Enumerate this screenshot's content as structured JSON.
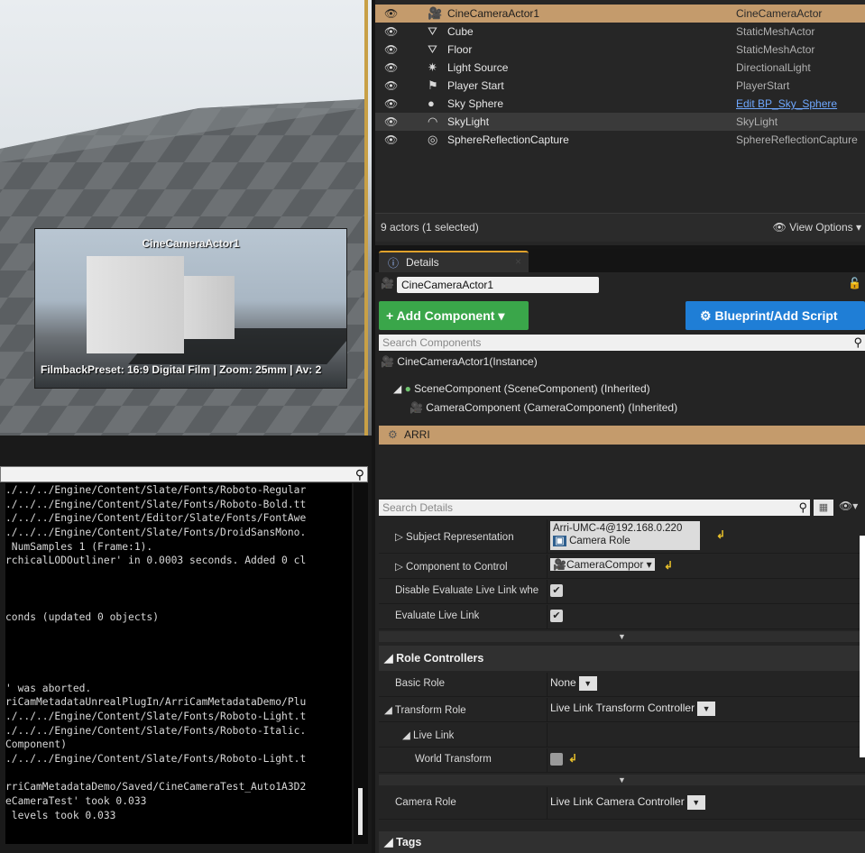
{
  "viewport": {
    "pip_title": "CineCameraActor1",
    "pip_info": "FilmbackPreset: 16:9 Digital Film | Zoom: 25mm | Av: 2"
  },
  "log": {
    "lines": [
      "./../../Engine/Content/Slate/Fonts/Roboto-Regular",
      "./../../Engine/Content/Slate/Fonts/Roboto-Bold.tt",
      "./../../Engine/Content/Editor/Slate/Fonts/FontAwe",
      "./../../Engine/Content/Slate/Fonts/DroidSansMono.",
      " NumSamples 1 (Frame:1).",
      "rchicalLODOutliner' in 0.0003 seconds. Added 0 cl",
      "",
      "",
      "",
      "conds (updated 0 objects)",
      "",
      "",
      "",
      "",
      "' was aborted.",
      "riCamMetadataUnrealPlugIn/ArriCamMetadataDemo/Plu",
      "./../../Engine/Content/Slate/Fonts/Roboto-Light.t",
      "./../../Engine/Content/Slate/Fonts/Roboto-Italic.",
      "Component)",
      "./../../Engine/Content/Slate/Fonts/Roboto-Light.t",
      "",
      "rriCamMetadataDemo/Saved/CineCameraTest_Auto1A3D2",
      "eCameraTest' took 0.033",
      " levels took 0.033"
    ]
  },
  "outliner": {
    "rows": [
      {
        "label": "CineCameraActor1",
        "type": "CineCameraActor",
        "icon": "cine-camera-icon",
        "glyph": "🎥",
        "state": "selected"
      },
      {
        "label": "Cube",
        "type": "StaticMeshActor",
        "icon": "static-mesh-icon",
        "glyph": "⛛",
        "state": ""
      },
      {
        "label": "Floor",
        "type": "StaticMeshActor",
        "icon": "static-mesh-icon",
        "glyph": "⛛",
        "state": ""
      },
      {
        "label": "Light Source",
        "type": "DirectionalLight",
        "icon": "directional-light-icon",
        "glyph": "✷",
        "state": ""
      },
      {
        "label": "Player Start",
        "type": "PlayerStart",
        "icon": "player-start-icon",
        "glyph": "⚑",
        "state": ""
      },
      {
        "label": "Sky Sphere",
        "type": "Edit BP_Sky_Sphere",
        "icon": "sky-sphere-icon",
        "glyph": "●",
        "state": "",
        "link": true
      },
      {
        "label": "SkyLight",
        "type": "SkyLight",
        "icon": "skylight-icon",
        "glyph": "◠",
        "state": "hover"
      },
      {
        "label": "SphereReflectionCapture",
        "type": "SphereReflectionCapture",
        "icon": "reflection-capture-icon",
        "glyph": "◎",
        "state": ""
      }
    ],
    "count": "9 actors (1 selected)",
    "view_options": "View Options"
  },
  "details": {
    "tab": "Details",
    "actor_name": "CineCameraActor1",
    "add_component": "Add Component",
    "blueprint": "Blueprint/Add Script",
    "search_components_placeholder": "Search Components",
    "instance": "CineCameraActor1(Instance)",
    "scene_component": "SceneComponent (SceneComponent) (Inherited)",
    "camera_component": "CameraComponent (CameraComponent) (Inherited)",
    "arri": "ARRI",
    "search_details_placeholder": "Search Details",
    "subject_representation": {
      "name": "Subject Representation",
      "value": "Arri-UMC-4@192.168.0.220",
      "role": "Camera Role"
    },
    "component_to_control": {
      "name": "Component to Control",
      "value": "CameraCompor"
    },
    "disable_evaluate": {
      "name": "Disable Evaluate Live Link whe"
    },
    "evaluate_live_link": {
      "name": "Evaluate Live Link"
    },
    "role_controllers": "Role Controllers",
    "basic_role": {
      "name": "Basic Role",
      "value": "None"
    },
    "transform_role": {
      "name": "Transform Role",
      "value": "Live Link Transform Controller"
    },
    "live_link": {
      "name": "Live Link"
    },
    "world_transform": {
      "name": "World Transform"
    },
    "camera_role": {
      "name": "Camera Role",
      "value": "Live Link Camera Controller"
    },
    "tags": "Tags"
  }
}
